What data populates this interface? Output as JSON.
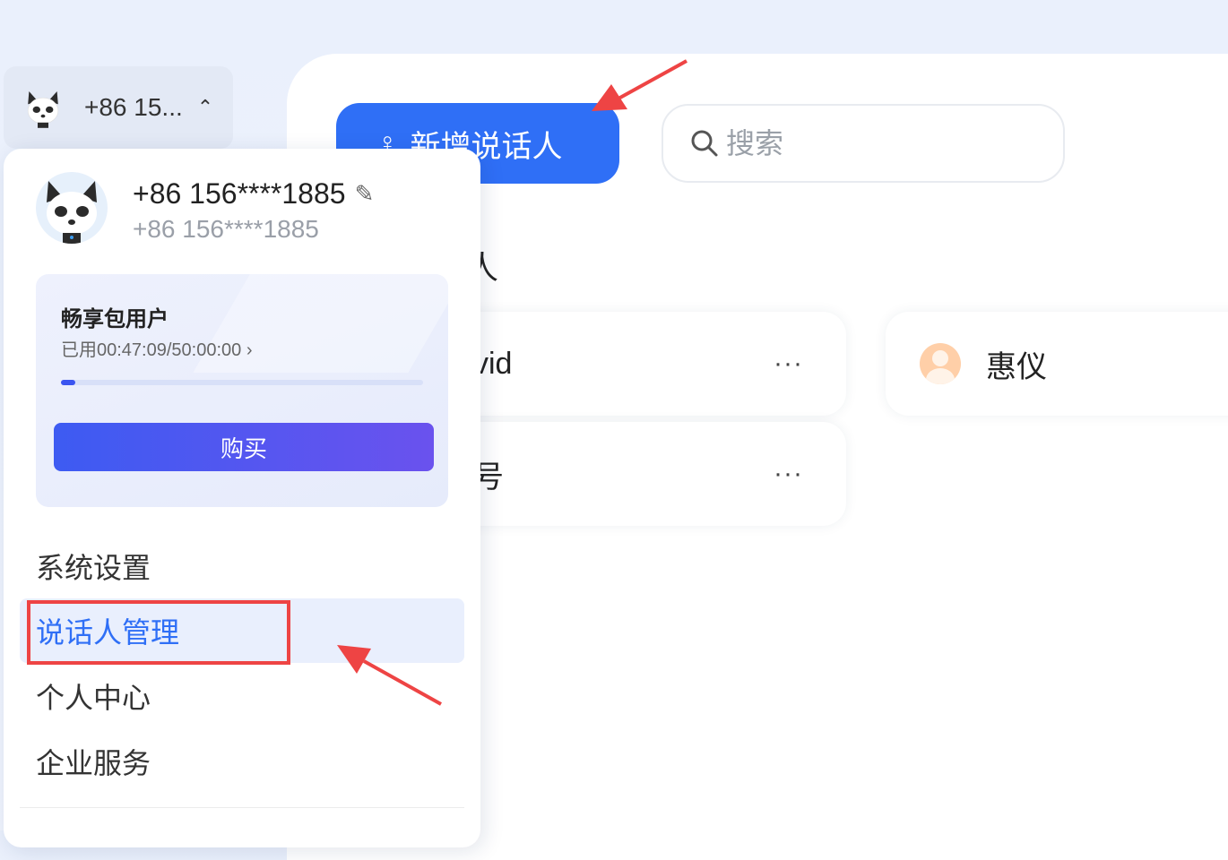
{
  "main": {
    "add_speaker_label": "新增说话人",
    "search_placeholder": "搜索",
    "section_title_fragment": "人",
    "cards": [
      {
        "name": "vid",
        "more": "···"
      },
      {
        "name": "惠仪"
      },
      {
        "name": "号",
        "more": "···"
      }
    ]
  },
  "user_chip": {
    "phone": "+86 15...",
    "caret": "⌃"
  },
  "dropdown": {
    "phone": "+86 156****1885",
    "sub_phone": "+86 156****1885",
    "plan": {
      "title": "畅享包用户",
      "usage": "已用00:47:09/50:00:00 ›",
      "usage_fraction": 0.016,
      "buy_label": "购买"
    },
    "menu": [
      {
        "label": "系统设置"
      },
      {
        "label": "说话人管理",
        "active": true
      },
      {
        "label": "个人中心"
      },
      {
        "label": "企业服务"
      }
    ]
  },
  "colors": {
    "primary": "#2f6ff6",
    "annotation_red": "#ee4444",
    "active_bg": "#e9effd"
  }
}
